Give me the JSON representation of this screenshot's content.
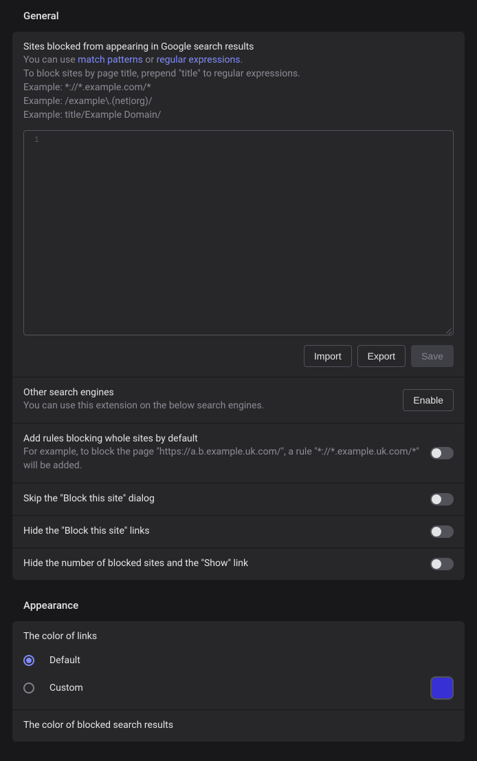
{
  "general": {
    "heading": "General",
    "block_sites": {
      "title": "Sites blocked from appearing in Google search results",
      "help_prefix": "You can use ",
      "help_link1": "match patterns",
      "help_mid": " or ",
      "help_link2": "regular expressions",
      "help_suffix": ".",
      "help_title_line": "To block sites by page title, prepend \"title\" to regular expressions.",
      "example1": "Example: *://*.example.com/*",
      "example2": "Example: /example\\.(net|org)/",
      "example3": "Example: title/Example Domain/",
      "line_number": "1",
      "editor_value": "",
      "import_label": "Import",
      "export_label": "Export",
      "save_label": "Save"
    },
    "other_engines": {
      "title": "Other search engines",
      "sub": "You can use this extension on the below search engines.",
      "enable_label": "Enable"
    },
    "whole_sites": {
      "title": "Add rules blocking whole sites by default",
      "sub": "For example, to block the page \"https://a.b.example.uk.com/\", a rule \"*://*.example.uk.com/*\" will be added."
    },
    "skip_dialog": {
      "title": "Skip the \"Block this site\" dialog"
    },
    "hide_links": {
      "title": "Hide the \"Block this site\" links"
    },
    "hide_count": {
      "title": "Hide the number of blocked sites and the \"Show\" link"
    }
  },
  "appearance": {
    "heading": "Appearance",
    "link_color": {
      "title": "The color of links",
      "default_label": "Default",
      "custom_label": "Custom",
      "custom_color": "#3730d4"
    },
    "blocked_color": {
      "title": "The color of blocked search results"
    }
  }
}
